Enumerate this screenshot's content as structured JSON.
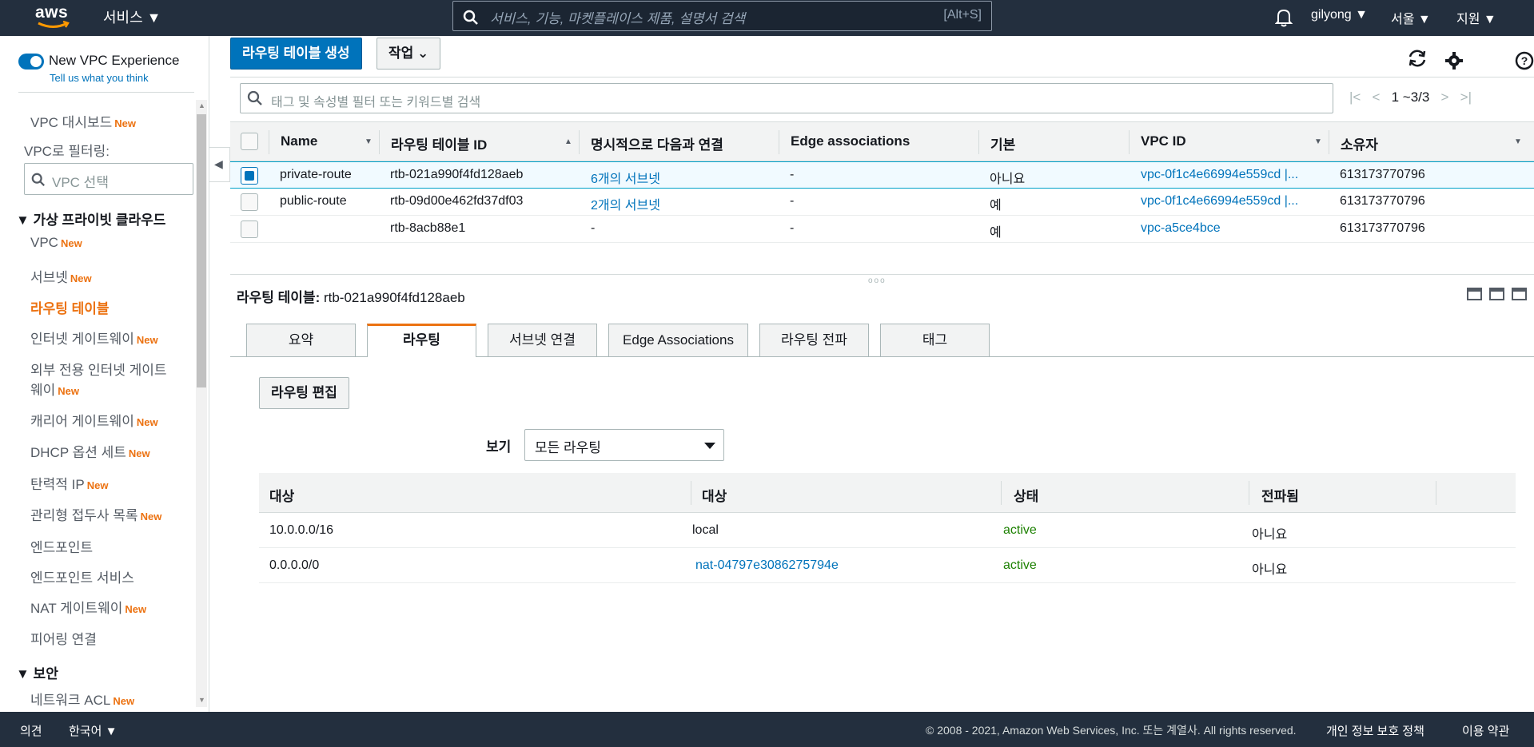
{
  "topnav": {
    "logo": "aws",
    "services": "서비스 ▼",
    "search_placeholder": "서비스, 기능, 마켓플레이스 제품, 설명서 검색",
    "search_shortcut": "[Alt+S]",
    "user": "gilyong ▼",
    "region": "서울 ▼",
    "support": "지원 ▼"
  },
  "sidebar": {
    "toggle_label": "New VPC Experience",
    "tell_us": "Tell us what you think",
    "dashboard": "VPC 대시보드",
    "filter_label": "VPC로 필터링:",
    "filter_placeholder": "VPC 선택",
    "section_vpc": "▼ 가상 프라이빗 클라우드",
    "new_badge": "New",
    "items": [
      {
        "label": "VPC",
        "new": "New"
      },
      {
        "label": "서브넷",
        "new": "New"
      },
      {
        "label": "라우팅 테이블",
        "new": ""
      },
      {
        "label": "인터넷 게이트웨이",
        "new": "New"
      },
      {
        "label": "외부 전용 인터넷 게이트",
        "new": ""
      },
      {
        "label": "웨이",
        "new": "New"
      },
      {
        "label": "캐리어 게이트웨이",
        "new": "New"
      },
      {
        "label": "DHCP 옵션 세트",
        "new": "New"
      },
      {
        "label": "탄력적 IP",
        "new": "New"
      },
      {
        "label": "관리형 접두사 목록",
        "new": "New"
      },
      {
        "label": "엔드포인트",
        "new": ""
      },
      {
        "label": "엔드포인트 서비스",
        "new": ""
      },
      {
        "label": "NAT 게이트웨이",
        "new": "New"
      },
      {
        "label": "피어링 연결",
        "new": ""
      }
    ],
    "section_security": "▼ 보안",
    "last_item": {
      "label": "네트워크 ACL",
      "new": "New"
    }
  },
  "toolbar": {
    "create_label": "라우팅 테이블 생성",
    "actions_label": "작업 ⌄"
  },
  "table": {
    "search_placeholder": "태그 및 속성별 필터 또는 키워드별 검색",
    "pager": "1 ~3/3",
    "headers": [
      "Name",
      "라우팅 테이블 ID",
      "명시적으로 다음과 연결",
      "Edge associations",
      "기본",
      "VPC ID",
      "소유자"
    ],
    "rows": [
      {
        "name": "private-route",
        "id": "rtb-021a990f4fd128aeb",
        "assoc": "6개의 서브넷",
        "edge": "-",
        "main": "아니요",
        "vpc": "vpc-0f1c4e66994e559cd |...",
        "owner": "613173770796"
      },
      {
        "name": "public-route",
        "id": "rtb-09d00e462fd37df03",
        "assoc": "2개의 서브넷",
        "edge": "-",
        "main": "예",
        "vpc": "vpc-0f1c4e66994e559cd |...",
        "owner": "613173770796"
      },
      {
        "name": "",
        "id": "rtb-8acb88e1",
        "assoc": "-",
        "edge": "-",
        "main": "예",
        "vpc": "vpc-a5ce4bce",
        "owner": "613173770796"
      }
    ]
  },
  "detail": {
    "title_label": "라우팅 테이블:",
    "title_value": "rtb-021a990f4fd128aeb",
    "tabs": [
      "요약",
      "라우팅",
      "서브넷 연결",
      "Edge Associations",
      "라우팅 전파",
      "태그"
    ],
    "edit_label": "라우팅 편집",
    "view_label": "보기",
    "view_value": "모든 라우팅",
    "route_headers": [
      "대상",
      "대상",
      "상태",
      "전파됨"
    ],
    "routes": [
      {
        "dest": "10.0.0.0/16",
        "target": "local",
        "status": "active",
        "propagated": "아니요"
      },
      {
        "dest": "0.0.0.0/0",
        "target": "nat-04797e3086275794e",
        "status": "active",
        "propagated": "아니요"
      }
    ]
  },
  "footer": {
    "feedback": "의견",
    "language": "한국어 ▼",
    "copyright": "© 2008 - 2021, Amazon Web Services, Inc. 또는 계열사. All rights reserved.",
    "privacy": "개인 정보 보호 정책",
    "terms": "이용 약관"
  }
}
